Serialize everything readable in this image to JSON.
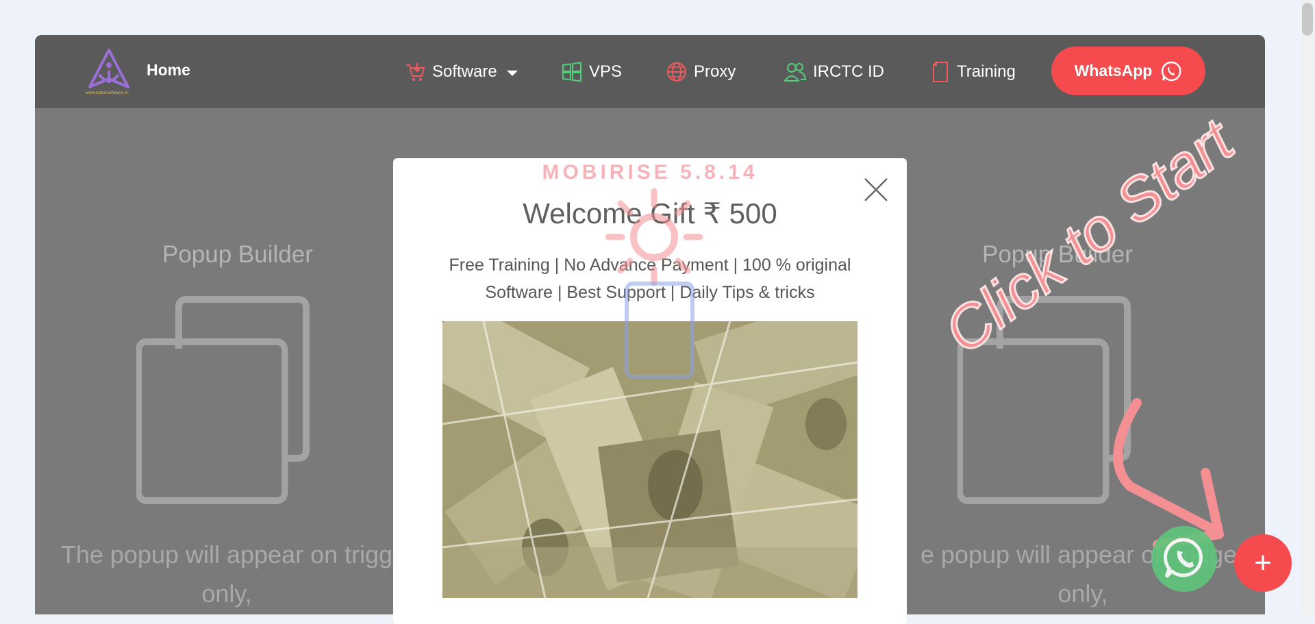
{
  "nav": {
    "brand": "Home",
    "logo_tagline": "www.tatkalsoftware.in",
    "items": [
      {
        "label": "Software",
        "icon": "cart-icon"
      },
      {
        "label": "VPS",
        "icon": "windows-icon"
      },
      {
        "label": "Proxy",
        "icon": "globe-icon"
      },
      {
        "label": "IRCTC ID",
        "icon": "users-icon"
      },
      {
        "label": "Training",
        "icon": "document-icon"
      }
    ],
    "whatsapp_label": "WhatsApp"
  },
  "cards": {
    "left_title": "Popup Builder",
    "right_title": "Popup Builder",
    "left_text_1": "The popup will appear on trigg",
    "left_text_2": "only,",
    "right_text_1": "e popup will appear on trigger",
    "right_text_2": "only,"
  },
  "modal": {
    "watermark": "MOBIRISE 5.8.14",
    "title": "Welcome Gift ₹ 500",
    "subtitle": "Free Training | No Advance Payment | 100 % original Software | Best Support | Daily Tips & tricks"
  },
  "overlay": {
    "hint": "Click to Start",
    "fab_plus": "+"
  },
  "colors": {
    "accent": "#f54b4e",
    "navbar": "#5a5a5a",
    "whatsapp_green": "#5ec57a"
  }
}
